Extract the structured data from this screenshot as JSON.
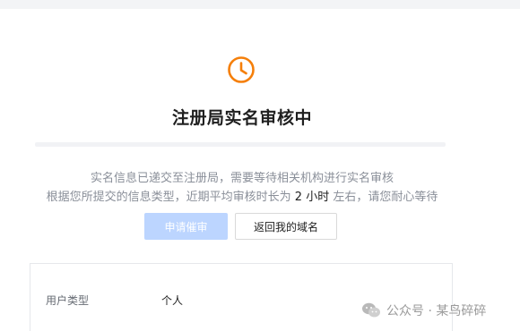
{
  "status": {
    "icon": "clock-icon",
    "icon_color": "#f57f0a",
    "title": "注册局实名审核中"
  },
  "description": {
    "line1": "实名信息已递交至注册局，需要等待相关机构进行实名审核",
    "line2_before": "根据您所提交的信息类型，近期平均审核时长为 ",
    "line2_highlight": "2 小时",
    "line2_after": " 左右，请您耐心等待"
  },
  "actions": {
    "urge_label": "申请催审",
    "urge_color": "#bcd5ff",
    "back_label": "返回我的域名"
  },
  "info": {
    "user_type_label": "用户类型",
    "user_type_value": "个人"
  },
  "watermark": {
    "text": "公众号 · 某鸟碎碎",
    "logo": "wechat-logo"
  }
}
